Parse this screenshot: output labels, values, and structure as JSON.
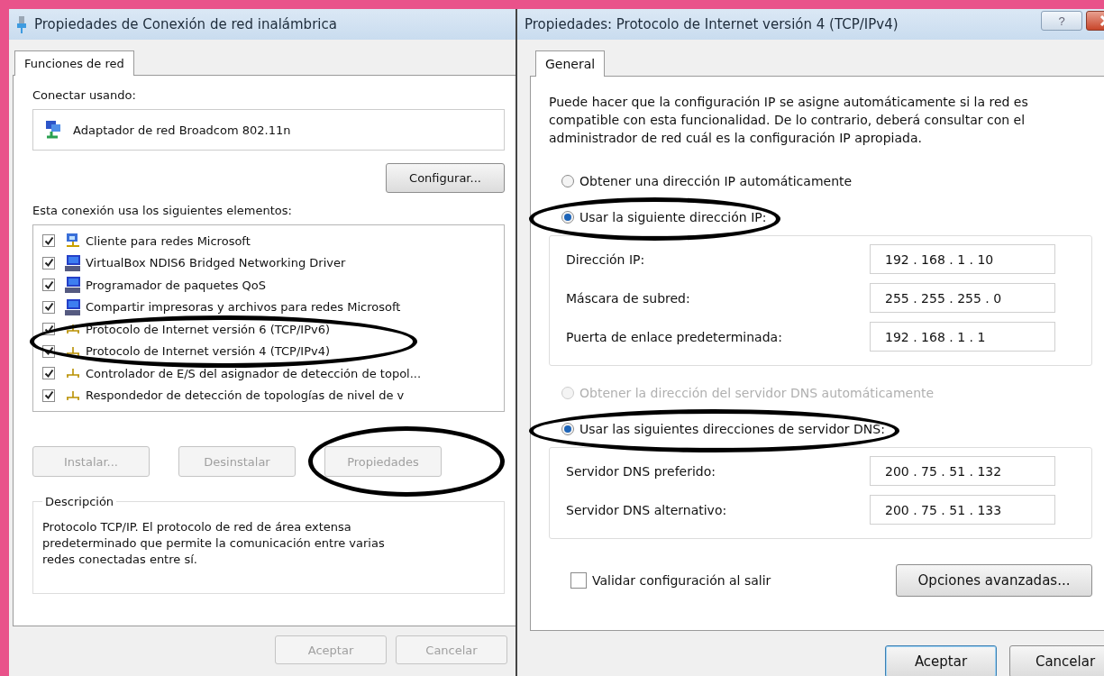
{
  "network_window": {
    "title": "Propiedades de Conexión de red inalámbrica",
    "tabs": [
      {
        "label": "Funciones de red",
        "selected": true
      }
    ],
    "connect_using_label": "Conectar usando:",
    "adapter": "Adaptador de red Broadcom 802.11n",
    "configure_button": "Configurar...",
    "elements_label": "Esta conexión usa los siguientes elementos:",
    "components": [
      {
        "label": "Cliente para redes Microsoft",
        "kind": "client",
        "checked": true,
        "circled": false
      },
      {
        "label": "VirtualBox NDIS6 Bridged Networking Driver",
        "kind": "service",
        "checked": true,
        "circled": false
      },
      {
        "label": "Programador de paquetes QoS",
        "kind": "service",
        "checked": true,
        "circled": false
      },
      {
        "label": "Compartir impresoras y archivos para redes Microsoft",
        "kind": "service",
        "checked": true,
        "circled": false
      },
      {
        "label": "Protocolo de Internet versión 6 (TCP/IPv6)",
        "kind": "protocol",
        "checked": true,
        "circled": true
      },
      {
        "label": "Protocolo de Internet versión 4 (TCP/IPv4)",
        "kind": "protocol",
        "checked": true,
        "circled": true
      },
      {
        "label": "Controlador de E/S del asignador de detección de topol...",
        "kind": "protocol",
        "checked": true,
        "circled": false
      },
      {
        "label": "Respondedor de detección de topologías de nivel de v",
        "kind": "protocol",
        "checked": true,
        "circled": false
      }
    ],
    "component_buttons": [
      {
        "label": "Instalar...",
        "disabled": true,
        "circled": false
      },
      {
        "label": "Desinstalar",
        "disabled": true,
        "circled": false
      },
      {
        "label": "Propiedades",
        "disabled": true,
        "circled": true
      }
    ],
    "description": {
      "legend": "Descripción",
      "text": "Protocolo TCP/IP. El protocolo de red de área extensa predeterminado que permite la comunicación entre varias redes conectadas entre sí."
    },
    "footer_buttons": [
      {
        "label": "Aceptar",
        "disabled": true
      },
      {
        "label": "Cancelar",
        "disabled": true
      }
    ]
  },
  "ipv4_dialog": {
    "title": "Propiedades: Protocolo de Internet versión 4 (TCP/IPv4)",
    "help_button": "?",
    "tabs": [
      {
        "label": "General",
        "selected": true
      }
    ],
    "intro": "Puede hacer que la configuración IP se asigne automáticamente si la red es compatible con esta funcionalidad. De lo contrario, deberá consultar con el administrador de red cuál es la configuración IP apropiada.",
    "ip_options": [
      {
        "label": "Obtener una dirección IP automáticamente",
        "selected": false,
        "disabled": false,
        "circled": false
      },
      {
        "label": "Usar la siguiente dirección IP:",
        "selected": true,
        "disabled": false,
        "circled": true
      }
    ],
    "ip_fields": [
      {
        "label": "Dirección IP:",
        "value": "192 . 168 . 1 . 10"
      },
      {
        "label": "Máscara de subred:",
        "value": "255 . 255 . 255 . 0"
      },
      {
        "label": "Puerta de enlace predeterminada:",
        "value": "192 . 168 . 1 . 1"
      }
    ],
    "dns_options": [
      {
        "label": "Obtener la dirección del servidor DNS automáticamente",
        "selected": false,
        "disabled": true,
        "circled": false
      },
      {
        "label": "Usar las siguientes direcciones de servidor DNS:",
        "selected": true,
        "disabled": false,
        "circled": true
      }
    ],
    "dns_fields": [
      {
        "label": "Servidor DNS preferido:",
        "value": "200 . 75 . 51 . 132"
      },
      {
        "label": "Servidor DNS alternativo:",
        "value": "200 . 75 . 51 . 133"
      }
    ],
    "validate": {
      "label": "Validar configuración al salir",
      "checked": false
    },
    "advanced_button": "Opciones avanzadas...",
    "footer_buttons": [
      {
        "label": "Aceptar",
        "default": true
      },
      {
        "label": "Cancelar",
        "default": false
      }
    ]
  }
}
